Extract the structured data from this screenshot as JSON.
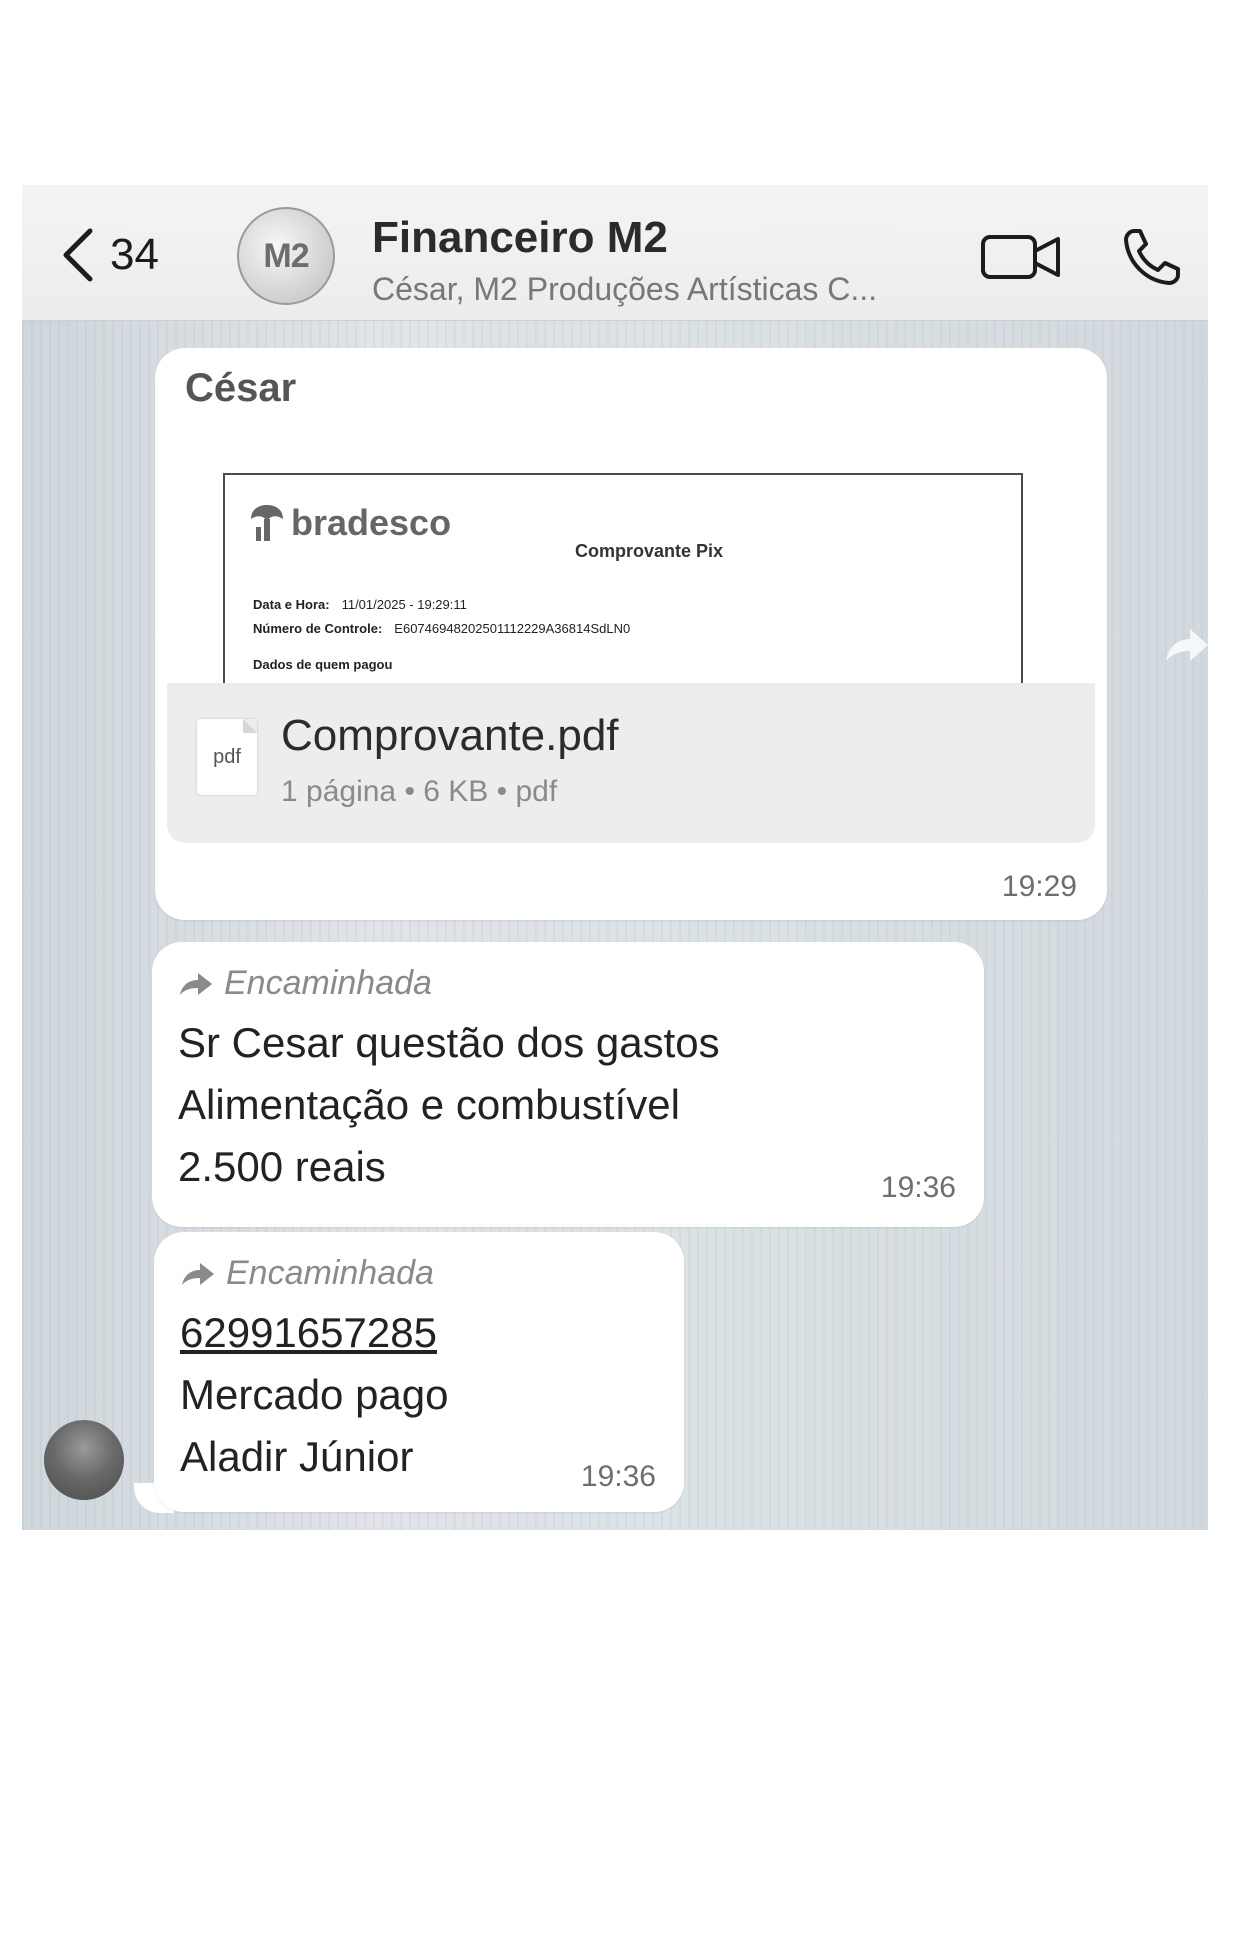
{
  "header": {
    "back_count": "34",
    "avatar_text": "M2",
    "title": "Financeiro M2",
    "subtitle": "César, M2 Produções Artísticas C..."
  },
  "messages": [
    {
      "sender": "César",
      "attachment": {
        "preview": {
          "logo": "bradesco",
          "doc_title": "Comprovante Pix",
          "datetime_label": "Data e Hora:",
          "datetime_value": "11/01/2025 - 19:29:11",
          "control_label": "Número de Controle:",
          "control_value": "E60746948202501112229A36814SdLN0",
          "payer_section": "Dados de quem pagou"
        },
        "file_icon_text": "pdf",
        "file_name": "Comprovante.pdf",
        "file_meta": "1 página • 6 KB • pdf"
      },
      "time": "19:29"
    },
    {
      "forwarded_label": "Encaminhada",
      "lines": [
        "Sr Cesar questão dos gastos",
        "Alimentação e combustível",
        "2.500 reais"
      ],
      "time": "19:36"
    },
    {
      "forwarded_label": "Encaminhada",
      "lines": [
        "62991657285",
        "Mercado pago",
        "Aladir Júnior"
      ],
      "time": "19:36"
    }
  ],
  "icons": {
    "back": "chevron-left-icon",
    "video": "video-camera-icon",
    "call": "phone-icon",
    "forward": "forward-arrow-icon",
    "share": "share-icon"
  }
}
